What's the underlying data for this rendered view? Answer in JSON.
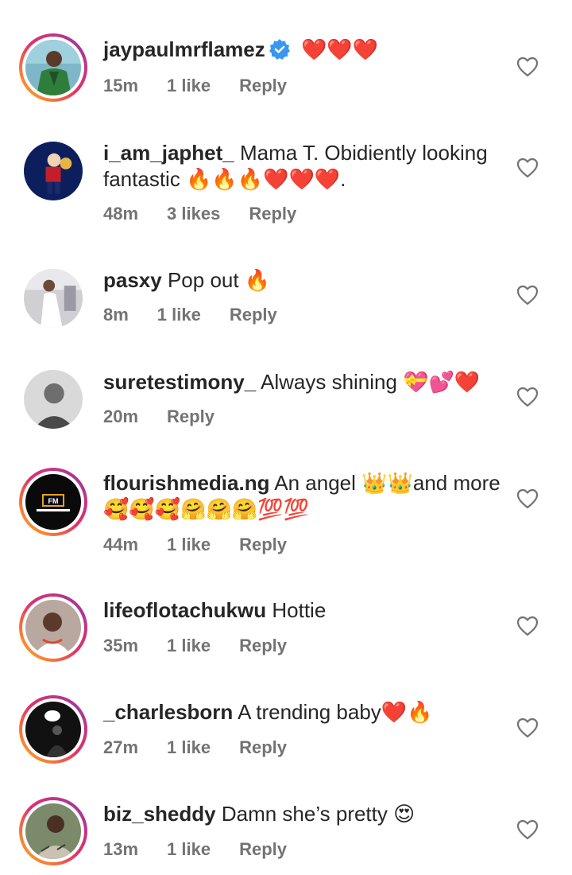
{
  "colors": {
    "text": "#262626",
    "meta": "#737373",
    "verified": "#3897f0"
  },
  "comments": [
    {
      "username": "jaypaulmrflamez",
      "verified": true,
      "text": "❤️❤️❤️",
      "time": "15m",
      "likes": "1 like",
      "reply": "Reply",
      "story_ring": true,
      "avatar_icon": "man-green-suit-avatar"
    },
    {
      "username": "i_am_japhet_",
      "text": "Mama T.  Obidiently looking fantastic 🔥🔥🔥❤️❤️❤️.",
      "time": "48m",
      "likes": "3 likes",
      "reply": "Reply",
      "story_ring": false,
      "avatar_icon": "child-avatar"
    },
    {
      "username": "pasxy",
      "text": "Pop out 🔥",
      "time": "8m",
      "likes": "1 like",
      "reply": "Reply",
      "story_ring": false,
      "avatar_icon": "woman-white-dress-avatar"
    },
    {
      "username": "suretestimony_",
      "text": "Always shining 💝💕❤️",
      "time": "20m",
      "likes": "",
      "reply": "Reply",
      "story_ring": false,
      "avatar_icon": "grayscale-person-avatar"
    },
    {
      "username": "flourishmedia.ng",
      "text": "An angel 👑👑and more 🥰🥰🥰🤗🤗🤗💯💯",
      "time": "44m",
      "likes": "1 like",
      "reply": "Reply",
      "story_ring": true,
      "avatar_icon": "flourish-media-logo-avatar"
    },
    {
      "username": "lifeoflotachukwu",
      "text": "Hottie",
      "time": "35m",
      "likes": "1 like",
      "reply": "Reply",
      "story_ring": true,
      "avatar_icon": "woman-selfie-avatar"
    },
    {
      "username": "_charlesborn",
      "text": "A trending baby❤️🔥",
      "time": "27m",
      "likes": "1 like",
      "reply": "Reply",
      "story_ring": true,
      "avatar_icon": "dark-silhouette-avatar"
    },
    {
      "username": "biz_sheddy",
      "text": "Damn she’s pretty 😍",
      "time": "13m",
      "likes": "1 like",
      "reply": "Reply",
      "story_ring": true,
      "avatar_icon": "man-patterned-shirt-avatar"
    }
  ]
}
